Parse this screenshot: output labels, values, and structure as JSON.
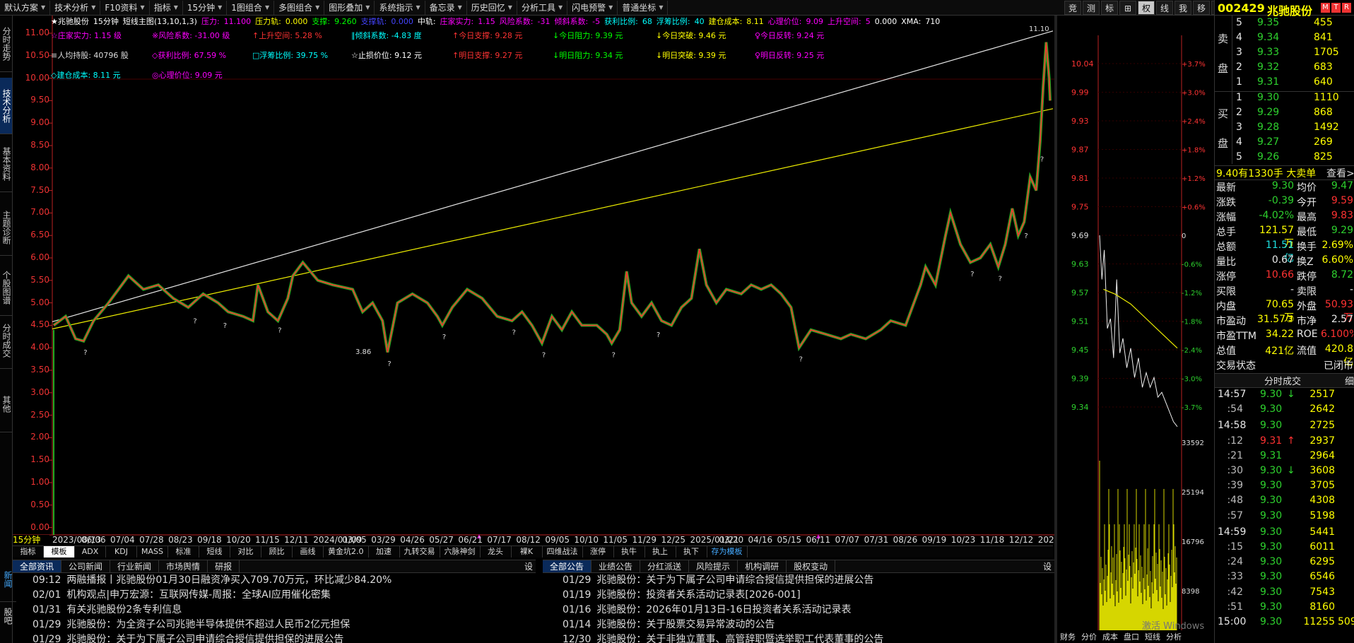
{
  "menu": [
    "默认方案",
    "技术分析",
    "F10资料",
    "指标",
    "15分钟",
    "1图组合",
    "多图组合",
    "图形叠加",
    "系统指示",
    "备忘录",
    "历史回忆",
    "分析工具",
    "闪电预警",
    "普通坐标"
  ],
  "tool_buttons": [
    "竞",
    "测",
    "标",
    "⊞",
    "权",
    "线",
    "我",
    "移",
    "▣",
    "≡",
    "✕"
  ],
  "left_tabs": [
    "分时走势",
    "技术分析",
    "基本资料",
    "主题诊断",
    "个股图谱",
    "分时成交",
    "其他"
  ],
  "header": {
    "title": "★兆驰股份",
    "period": "15分钟",
    "main_name": "短线主图(13,10,1,3)",
    "pressure": "压力:",
    "pressure_v": "11.100",
    "pressure_rail": "压力轨:",
    "pressure_rail_v": "0.000",
    "support": "支撑:",
    "support_v": "9.260",
    "support_rail": "支撑轨:",
    "support_rail_v": "0.000",
    "mid": "中轨:",
    "zhuang": "庄家实力:",
    "zhuang_v": "1.15",
    "risk": "风险系数:",
    "risk_v": "-31",
    "tilt": "倾斜系数:",
    "tilt_v": "-5",
    "profit": "获利比例:",
    "profit_v": "68",
    "float": "浮筹比例:",
    "float_v": "40",
    "cost": "建仓成本:",
    "cost_v": "8.11",
    "heart": "心理价位:",
    "heart_v": "9.09",
    "upspace": "上升空间:",
    "upspace_v": "5",
    "zero": "0.000",
    "xma": "XMA:",
    "xma_v": "710"
  },
  "indicators": {
    "r1": [
      "☆庄家实力: 1.15 级",
      "※风险系数: -31.00 级",
      "↑上升空间: 5.28 %",
      "∥倾斜系数: -4.83 度",
      "↑今日支撑: 9.28 元",
      "↓今日阻力: 9.39 元",
      "↓今日突破: 9.46 元",
      "♀今日反转: 9.24 元"
    ],
    "r2": [
      "≡人均持股: 40796 股",
      "◇获利比例: 67.59 %",
      "□浮筹比例: 39.75 %",
      "☆止损价位: 9.12 元",
      "↑明日支撑: 9.27 元",
      "↓明日阻力: 9.34 元",
      "↓明日突破: 9.39 元",
      "♀明日反转: 9.25 元"
    ],
    "r3": [
      "◇建仓成本: 8.11 元",
      "◎心理价位: 9.09 元"
    ]
  },
  "price_labels": [
    "11.00",
    "10.50",
    "10.00",
    "9.50",
    "9.00",
    "8.50",
    "8.00",
    "7.50",
    "7.00",
    "6.50",
    "6.00",
    "5.50",
    "5.00",
    "4.50",
    "4.00",
    "3.50",
    "3.00",
    "2.50",
    "2.00",
    "1.50",
    "1.00",
    "0.50",
    "0.00"
  ],
  "x_labels": [
    "2023/08/13",
    "06/06",
    "07/04",
    "07/28",
    "08/23",
    "09/18",
    "10/20",
    "11/15",
    "12/11",
    "2024/01/09",
    "03/05",
    "03/29",
    "04/26",
    "05/27",
    "06/21",
    "07/17",
    "08/12",
    "09/05",
    "10/10",
    "11/05",
    "11/29",
    "12/25",
    "2025/01/21",
    "03/20",
    "04/16",
    "05/15",
    "06/11",
    "07/07",
    "07/31",
    "08/26",
    "09/19",
    "10/23",
    "11/18",
    "12/12",
    "2026/"
  ],
  "period_label": "15分钟",
  "annot_high": "11.10",
  "annot_low": "3.86",
  "bottom_tabs": [
    "指标",
    "模板",
    "ADX",
    "KDJ",
    "MASS",
    "标准",
    "短线",
    "对比",
    "顾比",
    "画线",
    "黄金坑2.0",
    "加速",
    "九转交易",
    "六脉神剑",
    "龙头",
    "裸K",
    "四维战法",
    "涨停",
    "执牛",
    "执上",
    "执下",
    "存为模板"
  ],
  "news_left_label": "新闻",
  "news_left_label2": "股吧",
  "news1": {
    "tabs": [
      "全部资讯",
      "公司新闻",
      "行业新闻",
      "市场舆情",
      "研报"
    ],
    "set": "设",
    "rows": [
      {
        "d": "09:12",
        "t": "两融播报丨兆驰股份01月30日融资净买入709.70万元，环比减少84.20%"
      },
      {
        "d": "02/01",
        "t": "机构观点|申万宏源：互联网传媒-周报：全球AI应用催化密集"
      },
      {
        "d": "01/31",
        "t": "有关兆驰股份2条专利信息"
      },
      {
        "d": "01/29",
        "t": "兆驰股份：为全资子公司兆驰半导体提供不超过人民币2亿元担保"
      },
      {
        "d": "01/29",
        "t": "兆驰股份：关于为下属子公司申请综合授信提供担保的进展公告"
      }
    ]
  },
  "news2": {
    "tabs": [
      "全部公告",
      "业绩公告",
      "分红派送",
      "风险提示",
      "机构调研",
      "股权变动"
    ],
    "set": "设",
    "rows": [
      {
        "d": "01/29",
        "t": "兆驰股份：关于为下属子公司申请综合授信提供担保的进展公告"
      },
      {
        "d": "01/19",
        "t": "兆驰股份：投资者关系活动记录表[2026-001]"
      },
      {
        "d": "01/16",
        "t": "兆驰股份：2026年01月13日-16日投资者关系活动记录表"
      },
      {
        "d": "01/14",
        "t": "兆驰股份：关于股票交易异常波动的公告"
      },
      {
        "d": "12/30",
        "t": "兆驰股份：关于非独立董事、高管辞职暨选举职工代表董事的公告"
      }
    ]
  },
  "mini": {
    "prices": [
      "10.04",
      "9.99",
      "9.93",
      "9.87",
      "9.81",
      "9.75",
      "9.69",
      "9.63",
      "9.57",
      "9.51",
      "9.45",
      "9.39",
      "9.34"
    ],
    "pcts": [
      "+3.7%",
      "+3.0%",
      "+2.4%",
      "+1.8%",
      "+1.2%",
      "+0.6%",
      "0",
      "-0.6%",
      "-1.2%",
      "-1.8%",
      "-2.4%",
      "-3.0%",
      "-3.7%"
    ],
    "vols": [
      "33592",
      "25194",
      "16796",
      "8398"
    ],
    "btabs": [
      "财务",
      "分价",
      "成本",
      "盘口",
      "短线",
      "分析"
    ],
    "watermark": "激活 Windows"
  },
  "quote": {
    "code": "002429",
    "name": "兆驰股份",
    "badges": [
      "M",
      "T",
      "R"
    ],
    "sell_label": [
      "卖",
      "盘"
    ],
    "buy_label": [
      "买",
      "盘"
    ],
    "sell": [
      [
        "5",
        "9.35",
        "455"
      ],
      [
        "4",
        "9.34",
        "841"
      ],
      [
        "3",
        "9.33",
        "1705"
      ],
      [
        "2",
        "9.32",
        "683"
      ],
      [
        "1",
        "9.31",
        "640"
      ]
    ],
    "buy": [
      [
        "1",
        "9.30",
        "1110"
      ],
      [
        "2",
        "9.29",
        "868"
      ],
      [
        "3",
        "9.28",
        "1492"
      ],
      [
        "4",
        "9.27",
        "269"
      ],
      [
        "5",
        "9.26",
        "825"
      ]
    ],
    "bigorder": "9.40有1330手 大卖单",
    "bigorder_more": "查看>",
    "stats": [
      [
        "最新",
        "9.30",
        "均价",
        "9.47"
      ],
      [
        "涨跌",
        "-0.39",
        "今开",
        "9.59"
      ],
      [
        "涨幅",
        "-4.02%",
        "最高",
        "9.83"
      ],
      [
        "总手",
        "121.57万",
        "最低",
        "9.29"
      ],
      [
        "总额",
        "11.51亿",
        "换手",
        "2.69%"
      ],
      [
        "量比",
        "0.67",
        "换Z",
        "6.60%"
      ],
      [
        "涨停",
        "10.66",
        "跌停",
        "8.72"
      ],
      [
        "买限",
        "-",
        "卖限",
        "-"
      ],
      [
        "内盘",
        "70.65万",
        "外盘",
        "50.93万"
      ],
      [
        "市盈动",
        "31.57③",
        "市净",
        "2.57"
      ],
      [
        "市盈TTM",
        "34.22",
        "ROE",
        "6.100%"
      ],
      [
        "总值",
        "421亿",
        "流值",
        "420.8亿"
      ],
      [
        "交易状态",
        "",
        "",
        "已闭市"
      ]
    ],
    "ticks_title": "分时成交",
    "ticks_more": "细",
    "ticks": [
      [
        "14:57",
        "9.30",
        "↓",
        "2517"
      ],
      [
        ":54",
        "9.30",
        "",
        "2642"
      ],
      [
        "14:58",
        "9.30",
        "",
        "2725"
      ],
      [
        ":12",
        "9.31",
        "↑",
        "2937"
      ],
      [
        ":21",
        "9.31",
        "",
        "2964"
      ],
      [
        ":30",
        "9.30",
        "↓",
        "3608"
      ],
      [
        ":39",
        "9.30",
        "",
        "3705"
      ],
      [
        ":48",
        "9.30",
        "",
        "4308"
      ],
      [
        ":57",
        "9.30",
        "",
        "5198"
      ],
      [
        "14:59",
        "9.30",
        "",
        "5441"
      ],
      [
        ":15",
        "9.30",
        "",
        "6011"
      ],
      [
        ":24",
        "9.30",
        "",
        "6295"
      ],
      [
        ":33",
        "9.30",
        "",
        "6546"
      ],
      [
        ":42",
        "9.30",
        "",
        "7543"
      ],
      [
        ":51",
        "9.30",
        "",
        "8160"
      ],
      [
        "15:00",
        "9.30",
        "",
        "11255"
      ]
    ],
    "ticks_last_extra": "509"
  }
}
